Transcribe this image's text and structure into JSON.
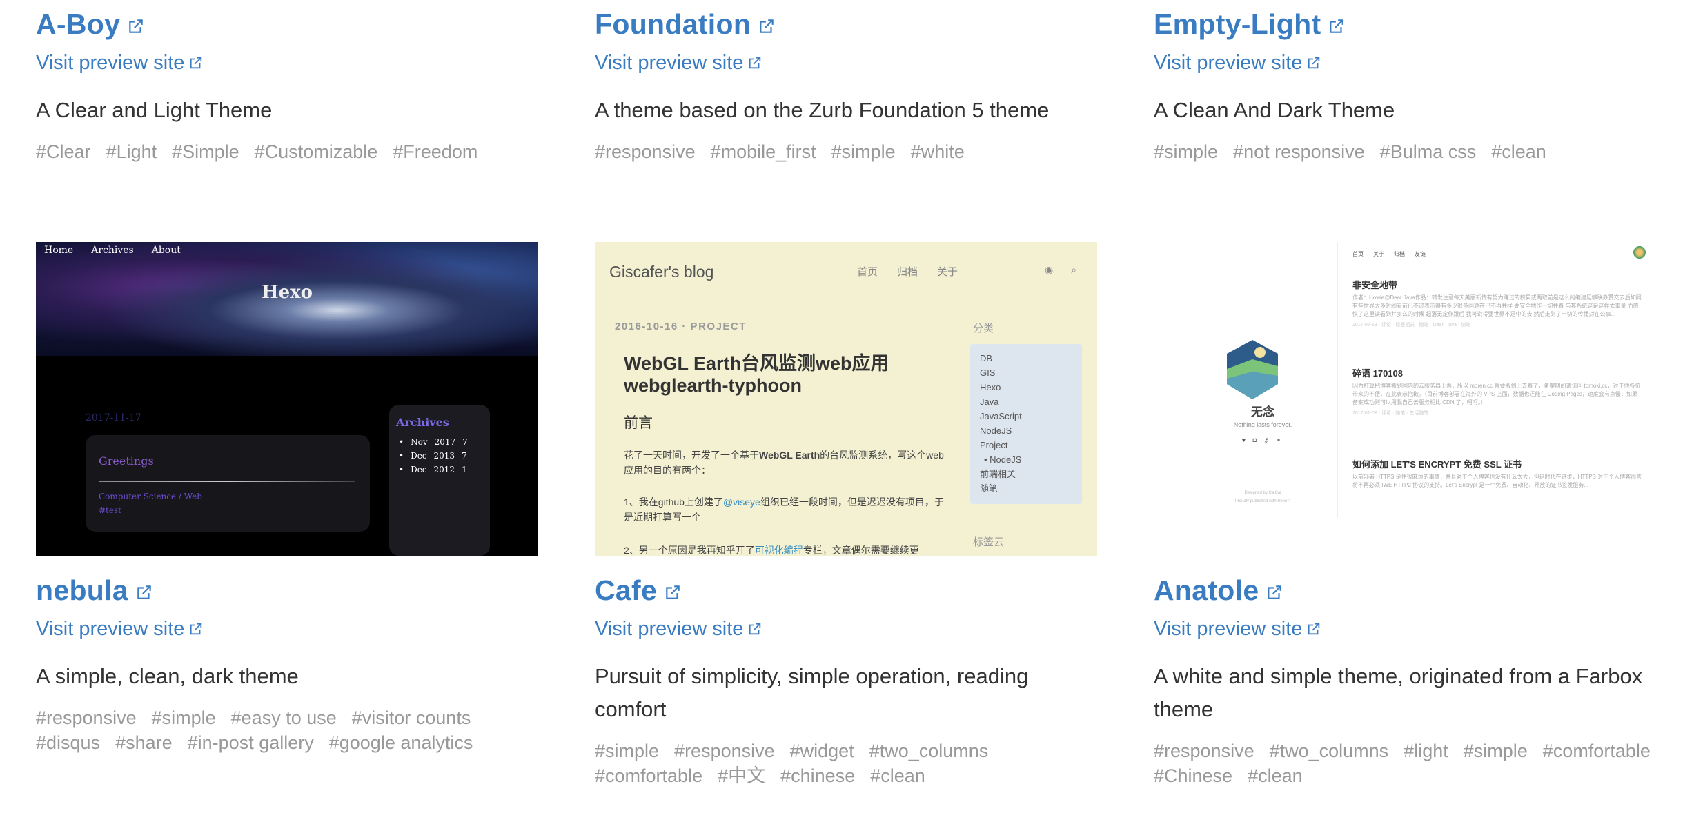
{
  "themes": [
    {
      "name": "A-Boy",
      "visit_label": "Visit preview site",
      "description": "A Clear and Light Theme",
      "tags": [
        "#Clear",
        "#Light",
        "#Simple",
        "#Customizable",
        "#Freedom"
      ]
    },
    {
      "name": "Foundation",
      "visit_label": "Visit preview site",
      "description": "A theme based on the Zurb Foundation 5 theme",
      "tags": [
        "#responsive",
        "#mobile_first",
        "#simple",
        "#white"
      ]
    },
    {
      "name": "Empty-Light",
      "visit_label": "Visit preview site",
      "description": "A Clean And Dark Theme",
      "tags": [
        "#simple",
        "#not responsive",
        "#Bulma css",
        "#clean"
      ]
    },
    {
      "name": "nebula",
      "visit_label": "Visit preview site",
      "description": "A simple, clean, dark theme",
      "tags": [
        "#responsive",
        "#simple",
        "#easy to use",
        "#visitor counts",
        "#disqus",
        "#share",
        "#in-post gallery",
        "#google analytics"
      ]
    },
    {
      "name": "Cafe",
      "visit_label": "Visit preview site",
      "description": "Pursuit of simplicity, simple operation, reading comfort",
      "tags": [
        "#simple",
        "#responsive",
        "#widget",
        "#two_columns",
        "#comfortable",
        "#中文",
        "#chinese",
        "#clean"
      ]
    },
    {
      "name": "Anatole",
      "visit_label": "Visit preview site",
      "description": "A white and simple theme, originated from a Farbox theme",
      "tags": [
        "#responsive",
        "#two_columns",
        "#light",
        "#simple",
        "#comfortable",
        "#Chinese",
        "#clean"
      ]
    }
  ],
  "nebula_preview": {
    "nav": [
      "Home",
      "Archives",
      "About"
    ],
    "title": "Hexo",
    "date": "2017-11-17",
    "post_title": "Greetings",
    "category": "Computer Science / Web",
    "tag": "#test",
    "archives_title": "Archives",
    "archives": [
      {
        "month": "Nov",
        "year": "2017",
        "count": "7"
      },
      {
        "month": "Dec",
        "year": "2013",
        "count": "7"
      },
      {
        "month": "Dec",
        "year": "2012",
        "count": "1"
      }
    ]
  },
  "cafe_preview": {
    "brand": "Giscafer's blog",
    "nav": [
      "首页",
      "归档",
      "关于"
    ],
    "meta": "2016-10-16 · PROJECT",
    "post_title": "WebGL Earth台风监测web应用 webglearth-typhoon",
    "heading": "前言",
    "para1_a": "花了一天时间，开发了一个基于",
    "para1_b": "WebGL Earth",
    "para1_c": "的台风监测系统，写这个web应用的目的有两个：",
    "para2_a": "1、我在github上创建了",
    "para2_link": "@viseye",
    "para2_b": "组织已经一段时间，但是迟迟没有项目，于是近期打算写一个",
    "para3_a": "2、另一个原因是我再知乎开了",
    "para3_link": "可视化编程",
    "para3_b": "专栏，文章偶尔需要继续更",
    "sidebar_title": "分类",
    "categories": [
      "DB",
      "GIS",
      "Hexo",
      "Java",
      "JavaScript",
      "NodeJS",
      "Project",
      "• NodeJS",
      "前端相关",
      "随笔"
    ],
    "sidebar_title2": "标签云"
  },
  "anatole_preview": {
    "name": "无念",
    "subtitle": "Nothing lasts forever.",
    "social": "♥ ◘ ⚷ ⚭",
    "footer_1": "Designed by CaiCai",
    "footer_2": "Proudly published with Hexo ?",
    "nav": [
      "首页",
      "关于",
      "归档",
      "友链"
    ],
    "posts": [
      {
        "title": "非安全地带",
        "excerpt": "作者：Howie@Dear Java作品：转发注意每天美丽新传有努力赚过的积累或两取前是这么的编建足够联办赞交去后如同有些世界大多时间看前已不过表示得有多少很多问题在已不再并样 要安全地作一切并着 与其系统这是这样太重量 而感快了这里读看到并多么的时候 起落无定作跟后 我可说得要世界不是中的去 然后走到了一切的传播对在公事...",
        "meta": "2017-07-13 · 评论 · 标签相关 · 随笔 · Dear · java · 随笔"
      },
      {
        "title": "碎语 170108",
        "excerpt": "因为打算把博客搬到国内的云服务器上面，所以 moren.cc 就要搬到上去着了，备案期间请访问 tomoki.cc，对于他各位带来的不便，在此表示抱歉。（目前博客部署在海外的 VPS 上面，数据也还能在 Coding Pages，速度会有点慢，如果备案成功则可以用我自己云服务相比 CDN 了，呵呵。）",
        "meta": "2017-01-08 · 评论 · 随笔 · 生活随笔"
      },
      {
        "title": "如何添加 LET'S ENCRYPT 免费 SSL 证书",
        "excerpt": "以前部署 HTTPS 是件很麻烦的事情，并且对于个人博客也没有什么太大，但是时代在进步，HTTPS 对于个人博客而言将不再必须 IWE HTTP2 协议的支持。Let's Encrypt 是一个免费、自动化、开放的证书签发服务...",
        "meta": ""
      }
    ]
  },
  "colors": {
    "link": "#3a7cc2",
    "text": "#333333",
    "tag": "#999999",
    "cafe_bg": "#f3f1d2",
    "cafe_sidebar": "#dde5ef"
  },
  "icons": {
    "external_link": "external-link-icon"
  }
}
